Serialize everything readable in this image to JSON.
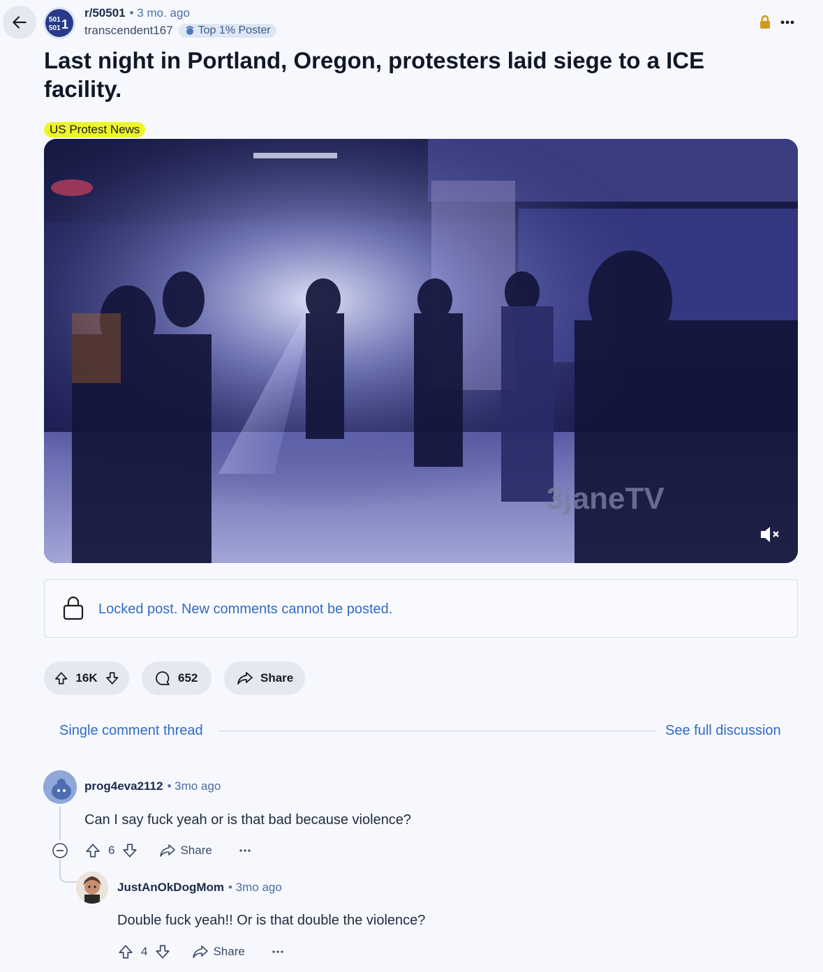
{
  "post": {
    "subreddit": "r/50501",
    "time": "• 3 mo. ago",
    "author": "transcendent167",
    "badge": "Top 1% Poster",
    "title": "Last night in Portland, Oregon, protesters laid siege to a ICE facility.",
    "flair": "US Protest News",
    "subreddit_icon_text": "501\n501",
    "watermark": "3janeTV"
  },
  "locked": {
    "message": "Locked post. New comments cannot be posted."
  },
  "actions": {
    "votes": "16K",
    "comments": "652",
    "share": "Share"
  },
  "thread": {
    "single_label": "Single comment thread",
    "full_label": "See full discussion"
  },
  "comments": [
    {
      "user": "prog4eva2112",
      "time": "• 3mo ago",
      "body": "Can I say fuck yeah or is that bad because violence?",
      "votes": "6",
      "share": "Share"
    },
    {
      "user": "JustAnOkDogMom",
      "time": "• 3mo ago",
      "body": "Double fuck yeah!! Or is that double the violence?",
      "votes": "4",
      "share": "Share"
    }
  ],
  "icons": {
    "back": "arrow-left-icon",
    "lock": "lock-icon",
    "more": "more-dots-icon",
    "upvote": "arrow-up-icon",
    "downvote": "arrow-down-icon",
    "comment": "comment-bubble-icon",
    "share": "share-arrow-icon",
    "mute": "speaker-muted-icon",
    "collapse": "minus-circle-icon"
  },
  "colors": {
    "link": "#2f6bc8",
    "flair": "#edf52a",
    "lock": "#d09a1a"
  }
}
